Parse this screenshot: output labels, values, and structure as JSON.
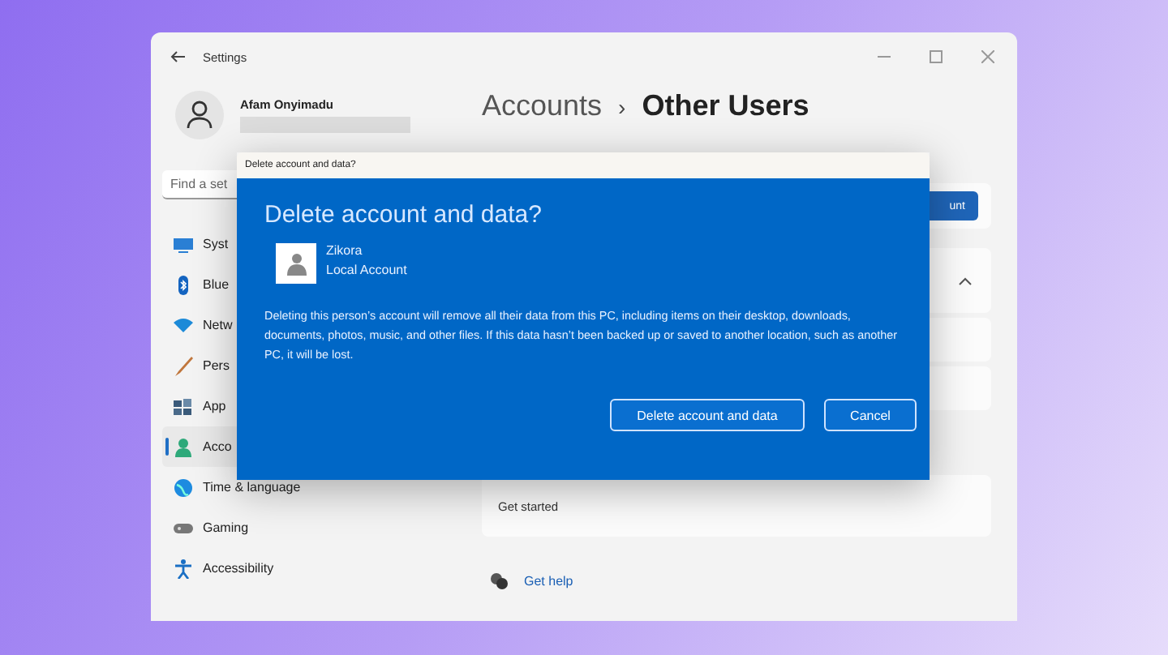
{
  "window": {
    "title": "Settings"
  },
  "profile": {
    "name": "Afam Onyimadu"
  },
  "search": {
    "placeholder": "Find a set"
  },
  "nav": [
    {
      "label": "Syst",
      "selected": false
    },
    {
      "label": "Blue",
      "selected": false
    },
    {
      "label": "Netw",
      "selected": false
    },
    {
      "label": "Pers",
      "selected": false
    },
    {
      "label": "App",
      "selected": false
    },
    {
      "label": "Acco",
      "selected": true
    },
    {
      "label": "Time & language",
      "selected": false
    },
    {
      "label": "Gaming",
      "selected": false
    },
    {
      "label": "Accessibility",
      "selected": false
    }
  ],
  "breadcrumb": {
    "parent": "Accounts",
    "separator": "›",
    "current": "Other Users"
  },
  "add_button": "unt",
  "get_started": "Get started",
  "get_help": "Get help",
  "dialog": {
    "caption": "Delete account and data?",
    "heading": "Delete account and data?",
    "user": {
      "name": "Zikora",
      "type": "Local Account"
    },
    "message": "Deleting this person’s account will remove all their data from this PC, including items on their desktop, downloads, documents, photos, music, and other files. If this data hasn’t been backed up or saved to another location, such as another PC, it will be lost.",
    "buttons": [
      {
        "label": "Delete account and data"
      },
      {
        "label": "Cancel"
      }
    ]
  }
}
